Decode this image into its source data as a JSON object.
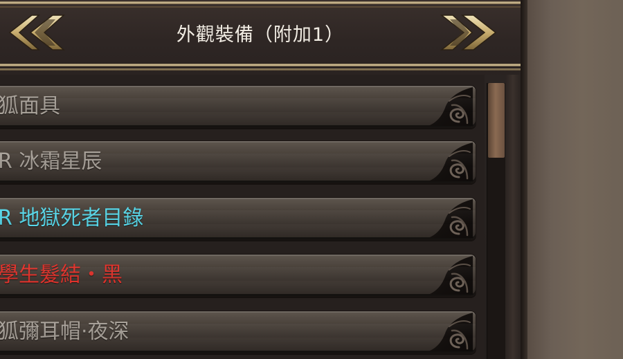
{
  "header": {
    "title": "外觀裝備（附加1）",
    "prev_icon": "double-chevron-left-icon",
    "next_icon": "double-chevron-right-icon"
  },
  "items": [
    {
      "label": "狐面具",
      "color": "#a9a29a"
    },
    {
      "label": "R 冰霜星辰",
      "color": "#a9a29a"
    },
    {
      "label": "R 地獄死者目錄",
      "color": "#58d8ea"
    },
    {
      "label": "學生髮結・黑",
      "color": "#e2332c"
    },
    {
      "label": "狐彌耳帽·夜深",
      "color": "#a9a29a"
    }
  ],
  "colors": {
    "accent_gold": "#d9c59a",
    "panel_dark": "#26201e",
    "scroll_thumb": "#8a6a52"
  },
  "scroll": {
    "position_fraction": 0.0
  }
}
